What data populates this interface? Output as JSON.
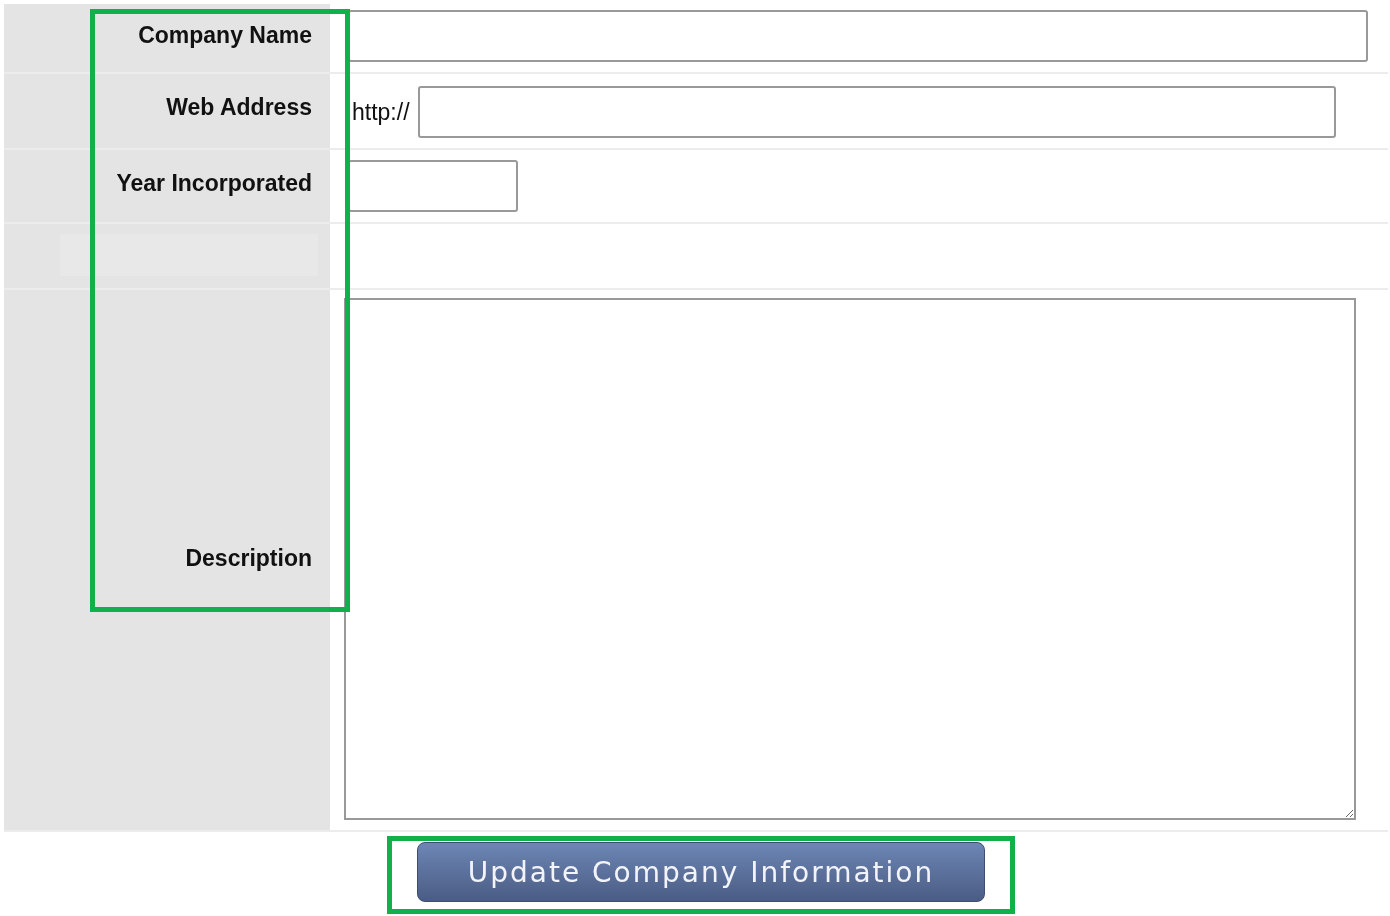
{
  "form": {
    "labels_highlighted": true,
    "fields": [
      {
        "kind": "text",
        "label": "Company Name"
      },
      {
        "kind": "url",
        "label": "Web Address",
        "prefix": "http://"
      },
      {
        "kind": "year",
        "label": "Year Incorporated"
      },
      {
        "kind": "spacer"
      },
      {
        "kind": "textarea",
        "label": "Description"
      }
    ]
  },
  "submit": {
    "label": "Update Company Information",
    "highlighted": true
  }
}
